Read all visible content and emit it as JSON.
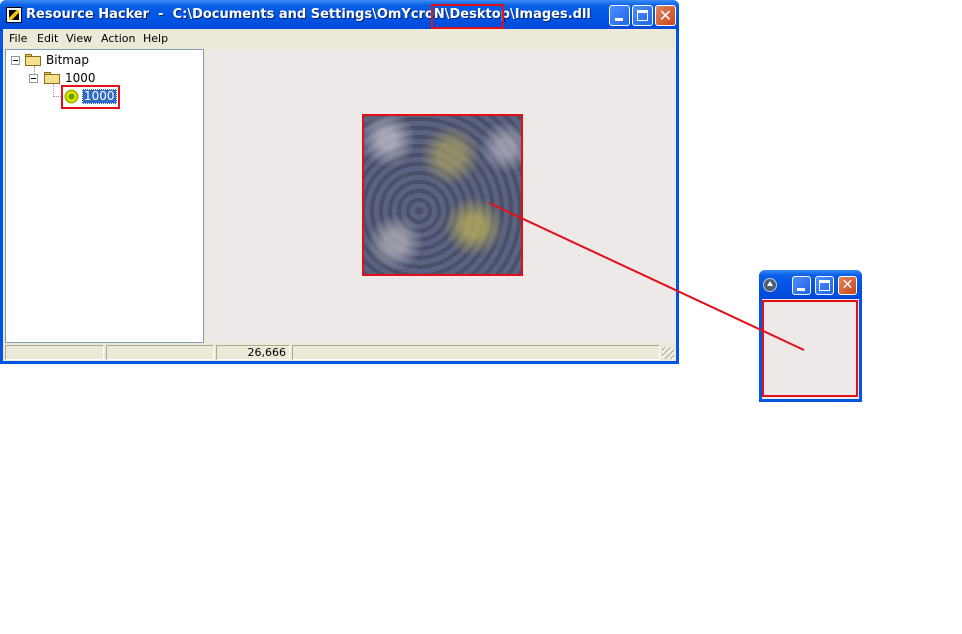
{
  "window": {
    "title_prefix": "Resource Hacker  -  C:\\Documents and Settings\\OmYcroN\\Desktop\\",
    "title_file": "Images.dll",
    "controls": {
      "minimize": "minimize-icon",
      "maximize": "maximize-icon",
      "close": "close-icon"
    }
  },
  "menu": [
    "File",
    "Edit",
    "View",
    "Action",
    "Help"
  ],
  "tree": {
    "root": {
      "label": "Bitmap",
      "icon": "folder-icon"
    },
    "child": {
      "label": "1000",
      "icon": "folder-icon"
    },
    "leaf": {
      "label": "1000",
      "icon": "resource-icon",
      "selected": true
    }
  },
  "statusbar": {
    "cells": [
      "",
      "",
      "26,666",
      ""
    ]
  },
  "annotation": {
    "highlight_color": "#e21018"
  },
  "small_window": {
    "controls": [
      "rollup-icon",
      "minimize-icon",
      "maximize-icon",
      "close-icon"
    ]
  }
}
